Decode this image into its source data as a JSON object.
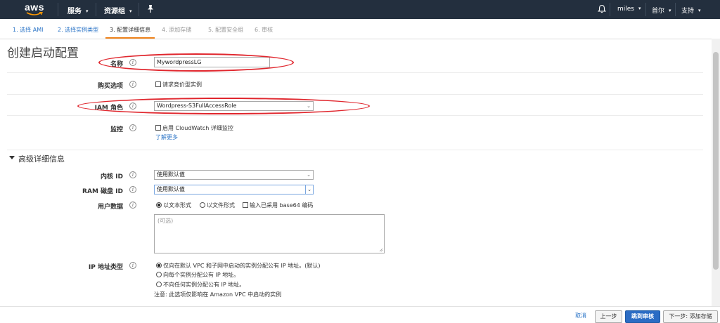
{
  "topnav": {
    "logo": "aws",
    "services": "服务",
    "resource_groups": "资源组",
    "pin_icon": "pushpin-icon",
    "bell_icon": "bell-icon",
    "user": "miles",
    "region": "首尔",
    "support": "支持"
  },
  "steps": [
    {
      "label": "1. 选择 AMI",
      "state": "link"
    },
    {
      "label": "2. 选择实例类型",
      "state": "link"
    },
    {
      "label": "3. 配置详细信息",
      "state": "active"
    },
    {
      "label": "4. 添加存储",
      "state": "disabled"
    },
    {
      "label": "5. 配置安全组",
      "state": "disabled"
    },
    {
      "label": "6. 审核",
      "state": "disabled"
    }
  ],
  "page": {
    "title": "创建启动配置"
  },
  "form": {
    "name_label": "名称",
    "name_value": "MywordpressLG",
    "purchase_label": "购买选项",
    "purchase_checkbox": "请求竞价型实例",
    "iam_label": "IAM 角色",
    "iam_value": "Wordpress-S3FullAccessRole",
    "monitoring_label": "监控",
    "monitoring_checkbox": "启用 CloudWatch 详细监控",
    "learn_more": "了解更多"
  },
  "advanced": {
    "title": "高级详细信息",
    "kernel_label": "内核 ID",
    "kernel_value": "使用默认值",
    "ramdisk_label": "RAM 磁盘 ID",
    "ramdisk_value": "使用默认值",
    "userdata_label": "用户数据",
    "userdata_opt_text": "以文本形式",
    "userdata_opt_file": "以文件形式",
    "userdata_base64": "输入已采用 base64 编码",
    "userdata_placeholder": "(可选)",
    "ip_label": "IP 地址类型",
    "ip_opt1": "仅向在默认 VPC 和子网中启动的实例分配公有 IP 地址。(默认)",
    "ip_opt2": "向每个实例分配公有 IP 地址。",
    "ip_opt3": "不向任何实例分配公有 IP 地址。",
    "note": "注意: 此选项仅影响在 Amazon VPC 中启动的实例"
  },
  "buttons": {
    "cancel": "取消",
    "previous": "上一步",
    "review": "跳到审核",
    "next": "下一步: 添加存储"
  },
  "colors": {
    "nav_bg": "#232f3e",
    "link": "#2c75c7",
    "primary": "#2b6cc4",
    "highlight_ellipse": "#e0262d",
    "active_step_underline": "#f0841c"
  }
}
